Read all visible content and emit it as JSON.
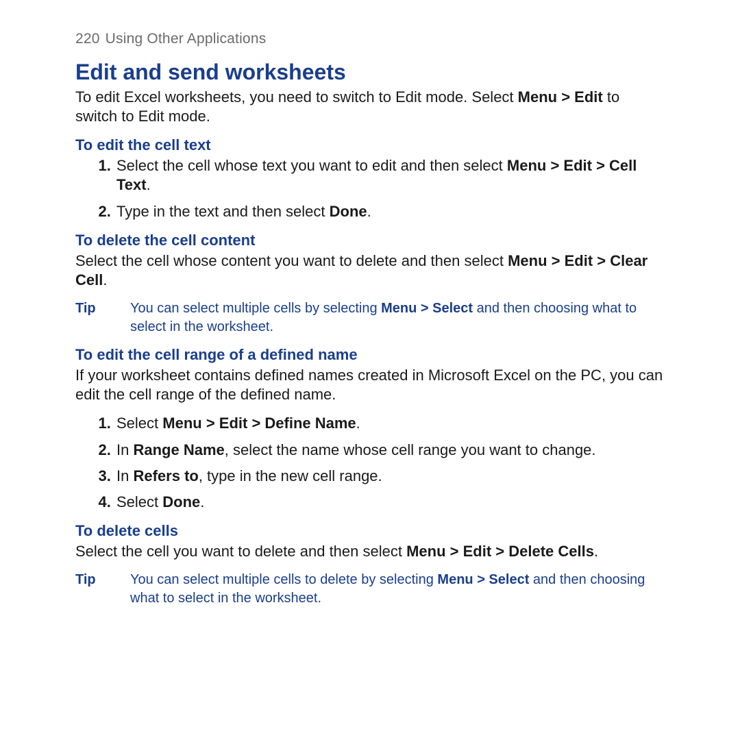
{
  "header": {
    "page_number": "220",
    "running_title": "Using Other Applications"
  },
  "section": {
    "title": "Edit and send worksheets",
    "intro_a": "To edit Excel worksheets, you need to switch to Edit mode. Select ",
    "intro_bold": "Menu > Edit",
    "intro_b": " to switch to Edit mode."
  },
  "edit_cell_text": {
    "heading": "To edit the cell text",
    "step1_a": "Select the cell whose text you want to edit and then select ",
    "step1_bold": "Menu > Edit > Cell Text",
    "step1_b": ".",
    "step2_a": "Type in the text and then select ",
    "step2_bold": "Done",
    "step2_b": "."
  },
  "delete_content": {
    "heading": "To delete the cell content",
    "body_a": "Select the cell whose content you want to delete and then select ",
    "body_bold": "Menu > Edit > Clear Cell",
    "body_b": "."
  },
  "tip1": {
    "label": "Tip",
    "a": "You can select multiple cells by selecting ",
    "bold": "Menu > Select",
    "b": " and then choosing what to select in the worksheet."
  },
  "edit_range": {
    "heading": "To edit the cell range of a defined name",
    "intro": "If your worksheet contains defined names created in Microsoft Excel on the PC, you can edit the cell range of the defined name.",
    "s1_a": "Select ",
    "s1_bold": "Menu > Edit > Define Name",
    "s1_b": ".",
    "s2_a": "In ",
    "s2_bold": "Range Name",
    "s2_b": ", select the name whose cell range you want to change.",
    "s3_a": "In ",
    "s3_bold": "Refers to",
    "s3_b": ", type in the new cell range.",
    "s4_a": "Select ",
    "s4_bold": "Done",
    "s4_b": "."
  },
  "delete_cells": {
    "heading": "To delete cells",
    "body_a": "Select the cell you want to delete and then select ",
    "body_bold": "Menu > Edit > Delete Cells",
    "body_b": "."
  },
  "tip2": {
    "label": "Tip",
    "a": "You can select multiple cells to delete by selecting ",
    "bold": "Menu > Select",
    "b": " and then choosing what to select in the worksheet."
  }
}
